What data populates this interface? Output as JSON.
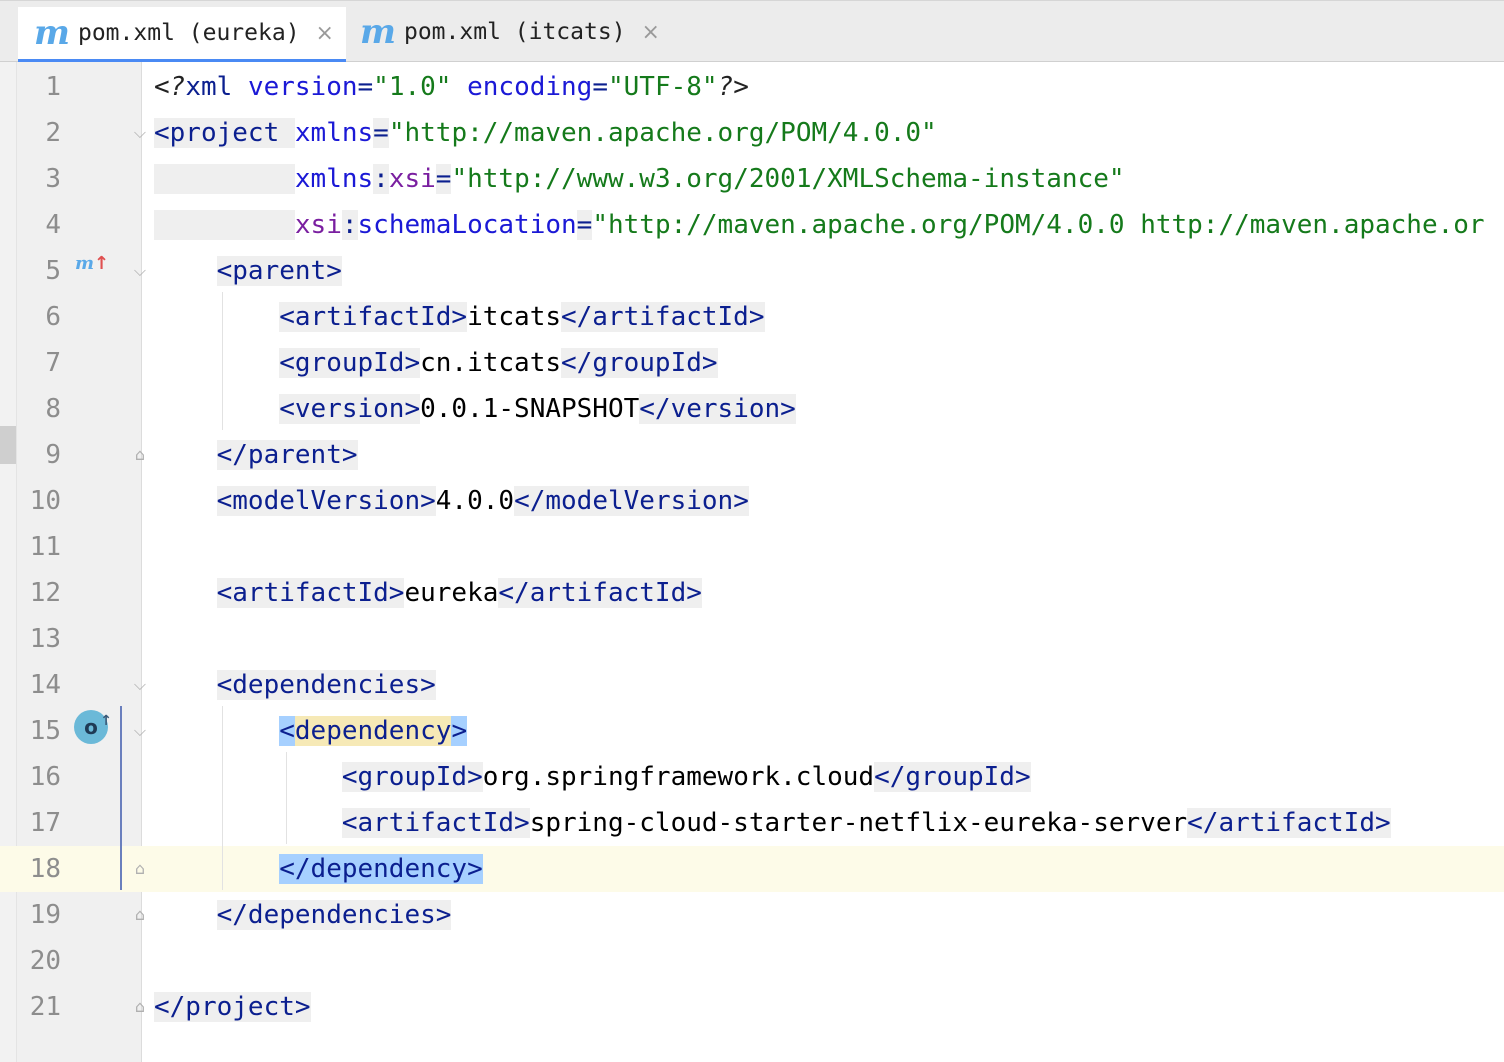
{
  "tabs": [
    {
      "icon": "m",
      "label": "pom.xml (eureka)",
      "close": "×",
      "active": true
    },
    {
      "icon": "m",
      "label": "pom.xml (itcats)",
      "close": "×",
      "active": false
    }
  ],
  "gutter_icons": {
    "maven_parent_icon": "m",
    "override_icon": "o"
  },
  "lines": [
    {
      "n": "1",
      "segments": [
        [
          "pi",
          "<?"
        ],
        [
          "tn",
          "xml "
        ],
        [
          "an",
          "version"
        ],
        [
          "tn",
          "="
        ],
        [
          "av",
          "\"1.0\""
        ],
        [
          "tn",
          " "
        ],
        [
          "an",
          "encoding"
        ],
        [
          "tn",
          "="
        ],
        [
          "av",
          "\"UTF-8\""
        ],
        [
          "pi",
          "?>"
        ]
      ]
    },
    {
      "n": "2",
      "segments": [
        [
          "tg",
          "<project "
        ],
        [
          "an",
          "xmlns"
        ],
        [
          "tg",
          "="
        ],
        [
          "av",
          "\"http://maven.apache.org/POM/4.0.0\""
        ]
      ]
    },
    {
      "n": "3",
      "segments": [
        [
          "tg",
          "         "
        ],
        [
          "an",
          "xmlns"
        ],
        [
          "tg",
          ":"
        ],
        [
          "ns",
          "xsi"
        ],
        [
          "tg",
          "="
        ],
        [
          "av",
          "\"http://www.w3.org/2001/XMLSchema-instance\""
        ]
      ]
    },
    {
      "n": "4",
      "segments": [
        [
          "tg",
          "         "
        ],
        [
          "ns",
          "xsi"
        ],
        [
          "tg",
          ":"
        ],
        [
          "an",
          "schemaLocation"
        ],
        [
          "tg",
          "="
        ],
        [
          "av",
          "\"http://maven.apache.org/POM/4.0.0 http://maven.apache.or"
        ]
      ]
    },
    {
      "n": "5",
      "segments": [
        [
          "txt",
          "    "
        ],
        [
          "tg",
          "<parent>"
        ]
      ]
    },
    {
      "n": "6",
      "segments": [
        [
          "txt",
          "        "
        ],
        [
          "tg",
          "<artifactId>"
        ],
        [
          "txt",
          "itcats"
        ],
        [
          "tg",
          "</artifactId>"
        ]
      ]
    },
    {
      "n": "7",
      "segments": [
        [
          "txt",
          "        "
        ],
        [
          "tg",
          "<groupId>"
        ],
        [
          "txt",
          "cn.itcats"
        ],
        [
          "tg",
          "</groupId>"
        ]
      ]
    },
    {
      "n": "8",
      "segments": [
        [
          "txt",
          "        "
        ],
        [
          "tg",
          "<version>"
        ],
        [
          "txt",
          "0.0.1-SNAPSHOT"
        ],
        [
          "tg",
          "</version>"
        ]
      ]
    },
    {
      "n": "9",
      "segments": [
        [
          "txt",
          "    "
        ],
        [
          "tg",
          "</parent>"
        ]
      ]
    },
    {
      "n": "10",
      "segments": [
        [
          "txt",
          "    "
        ],
        [
          "tg",
          "<modelVersion>"
        ],
        [
          "txt",
          "4.0.0"
        ],
        [
          "tg",
          "</modelVersion>"
        ]
      ]
    },
    {
      "n": "11",
      "segments": []
    },
    {
      "n": "12",
      "segments": [
        [
          "txt",
          "    "
        ],
        [
          "tg",
          "<artifactId>"
        ],
        [
          "txt",
          "eureka"
        ],
        [
          "tg",
          "</artifactId>"
        ]
      ]
    },
    {
      "n": "13",
      "segments": []
    },
    {
      "n": "14",
      "segments": [
        [
          "txt",
          "    "
        ],
        [
          "tg",
          "<dependencies>"
        ]
      ]
    },
    {
      "n": "15",
      "segments": [
        [
          "txt",
          "        "
        ],
        [
          "sel",
          "<"
        ],
        [
          "match",
          "dependency"
        ],
        [
          "sel",
          ">"
        ]
      ]
    },
    {
      "n": "16",
      "segments": [
        [
          "txt",
          "            "
        ],
        [
          "tg",
          "<groupId>"
        ],
        [
          "txt",
          "org.springframework.cloud"
        ],
        [
          "tg",
          "</groupId>"
        ]
      ]
    },
    {
      "n": "17",
      "segments": [
        [
          "txt",
          "            "
        ],
        [
          "tg",
          "<artifactId>"
        ],
        [
          "txt",
          "spring-cloud-starter-netflix-eureka-server"
        ],
        [
          "tg",
          "</artifactId>"
        ]
      ]
    },
    {
      "n": "18",
      "segments": [
        [
          "txt",
          "        "
        ],
        [
          "sel",
          "</dependency>"
        ]
      ]
    },
    {
      "n": "19",
      "segments": [
        [
          "txt",
          "    "
        ],
        [
          "tg",
          "</dependencies>"
        ]
      ]
    },
    {
      "n": "20",
      "segments": []
    },
    {
      "n": "21",
      "segments": [
        [
          "tg",
          "</project>"
        ]
      ]
    }
  ],
  "current_line": "18",
  "fold_markers": {
    "2": "⌵",
    "5": "⌵",
    "9": "⌂",
    "14": "⌵",
    "15": "⌵",
    "18": "⌂",
    "19": "⌂",
    "21": "⌂"
  }
}
